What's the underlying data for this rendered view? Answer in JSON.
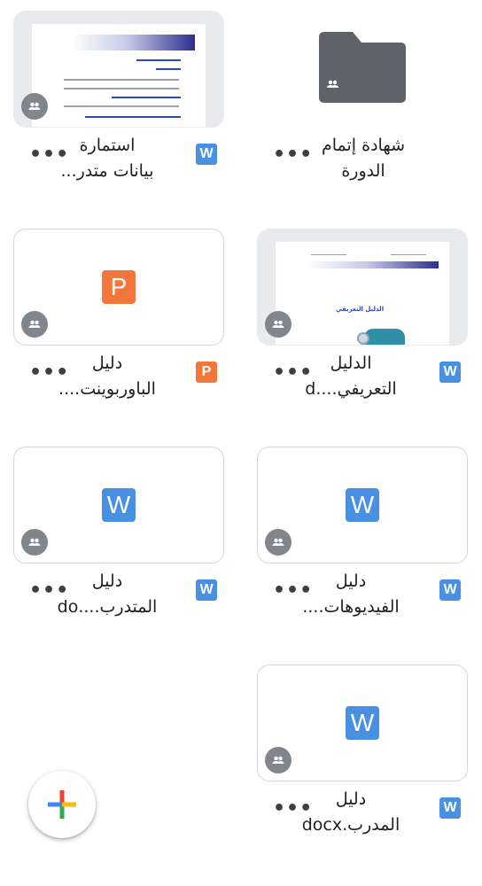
{
  "files": [
    {
      "name_line1": "شهادة إتمام",
      "name_line2": "الدورة",
      "type": "folder"
    },
    {
      "name_line1": "استمارة",
      "name_line2": "بيانات متدر...",
      "type": "W"
    },
    {
      "name_line1": "الدليل",
      "name_line2": "التعريفي....d",
      "type": "W"
    },
    {
      "name_line1": "دليل",
      "name_line2": "الباوربوينت....",
      "type": "P"
    },
    {
      "name_line1": "دليل",
      "name_line2": "الفيديوهات....",
      "type": "W"
    },
    {
      "name_line1": "دليل",
      "name_line2": "المتدرب....do",
      "type": "W"
    },
    {
      "name_line1": "دليل",
      "name_line2": "المدرب.docx",
      "type": "W"
    }
  ],
  "more_label": "•••",
  "thumb_doc2_header": "الدليل التعريفي",
  "colors": {
    "word": "#4a90e2",
    "ppt": "#f4763b",
    "folder": "#5f6368",
    "badge": "#80868b"
  },
  "icons": {
    "shared": "shared-people-icon",
    "fab": "plus-icon",
    "more": "more-horiz-icon"
  }
}
